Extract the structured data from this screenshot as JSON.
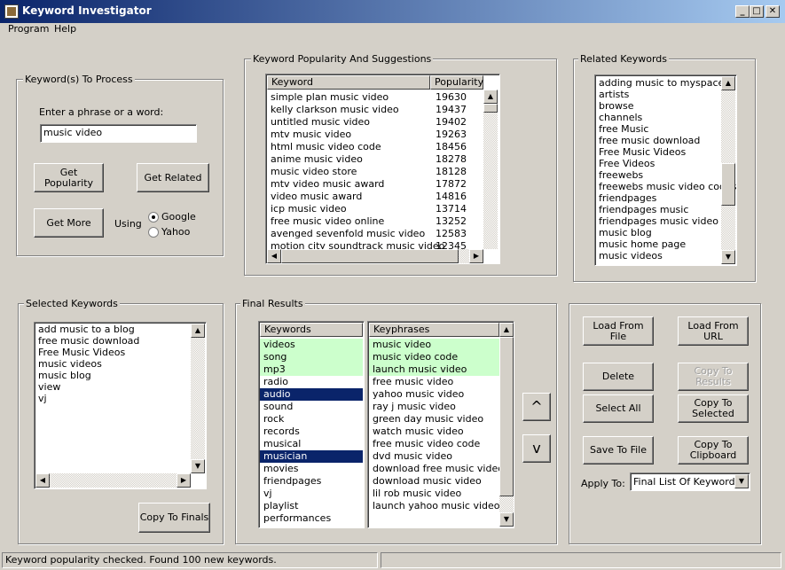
{
  "window": {
    "title": "Keyword Investigator",
    "minimize": "_",
    "maximize": "□",
    "close": "✕"
  },
  "menu": [
    "Program",
    "Help"
  ],
  "process": {
    "legend": "Keyword(s) To Process",
    "prompt": "Enter a phrase or a word:",
    "input_value": "music video",
    "get_popularity": "Get Popularity",
    "get_related": "Get Related",
    "get_more": "Get More",
    "using_label": "Using",
    "google": "Google",
    "yahoo": "Yahoo",
    "selected_engine": "Google"
  },
  "popularity": {
    "legend": "Keyword Popularity And Suggestions",
    "col_keyword": "Keyword",
    "col_popularity": "Popularity",
    "rows": [
      [
        "simple plan music video",
        "19630"
      ],
      [
        "kelly clarkson music video",
        "19437"
      ],
      [
        "untitled music video",
        "19402"
      ],
      [
        "mtv music video",
        "19263"
      ],
      [
        "html music video code",
        "18456"
      ],
      [
        "anime music video",
        "18278"
      ],
      [
        "music video store",
        "18128"
      ],
      [
        "mtv video music award",
        "17872"
      ],
      [
        "video music award",
        "14816"
      ],
      [
        "icp music video",
        "13714"
      ],
      [
        "free music video online",
        "13252"
      ],
      [
        "avenged sevenfold music video",
        "12583"
      ],
      [
        "motion city soundtrack music video",
        "12345"
      ]
    ]
  },
  "related": {
    "legend": "Related Keywords",
    "items": [
      "adding music to myspace",
      "artists",
      "browse",
      "channels",
      "free Music",
      "free music download",
      "Free Music Videos",
      "Free Videos",
      "freewebs",
      "freewebs music video codes",
      "friendpages",
      "friendpages music",
      "friendpages music video",
      "music blog",
      "music home page",
      "music videos"
    ]
  },
  "selected": {
    "legend": "Selected Keywords",
    "items": [
      "add music to a blog",
      "free music download",
      "Free Music Videos",
      "music videos",
      "music blog",
      "view",
      "vj"
    ],
    "copy_to_finals": "Copy To Finals"
  },
  "final": {
    "legend": "Final Results",
    "col_keywords": "Keywords",
    "col_keyphrases": "Keyphrases",
    "keywords": [
      {
        "text": "videos",
        "state": "green"
      },
      {
        "text": "song",
        "state": "green"
      },
      {
        "text": "mp3",
        "state": "green"
      },
      {
        "text": "radio",
        "state": ""
      },
      {
        "text": "audio",
        "state": "sel"
      },
      {
        "text": "sound",
        "state": ""
      },
      {
        "text": "rock",
        "state": ""
      },
      {
        "text": "records",
        "state": ""
      },
      {
        "text": "musical",
        "state": ""
      },
      {
        "text": "musician",
        "state": "sel"
      },
      {
        "text": "movies",
        "state": ""
      },
      {
        "text": "friendpages",
        "state": ""
      },
      {
        "text": "vj",
        "state": ""
      },
      {
        "text": "playlist",
        "state": ""
      },
      {
        "text": "performances",
        "state": ""
      }
    ],
    "keyphrases": [
      {
        "text": "music video",
        "state": "green"
      },
      {
        "text": "music video code",
        "state": "green"
      },
      {
        "text": "launch music video",
        "state": "green"
      },
      {
        "text": "free music video",
        "state": ""
      },
      {
        "text": "yahoo music video",
        "state": ""
      },
      {
        "text": "ray j music video",
        "state": ""
      },
      {
        "text": "green day music video",
        "state": ""
      },
      {
        "text": "watch music video",
        "state": ""
      },
      {
        "text": "free music video code",
        "state": ""
      },
      {
        "text": "dvd music video",
        "state": ""
      },
      {
        "text": "download free music video",
        "state": ""
      },
      {
        "text": "download music video",
        "state": ""
      },
      {
        "text": "lil rob music video",
        "state": ""
      },
      {
        "text": "launch yahoo music video",
        "state": ""
      }
    ],
    "move_up": "^",
    "move_down": "v"
  },
  "actions": {
    "load_from_file": "Load From File",
    "load_from_url": "Load From URL",
    "delete": "Delete",
    "copy_to_results": "Copy To Results",
    "select_all": "Select All",
    "copy_to_selected": "Copy To Selected",
    "save_to_file": "Save To File",
    "copy_to_clipboard": "Copy To Clipboard",
    "apply_to_label": "Apply To:",
    "apply_to_value": "Final List Of Keywords"
  },
  "status": {
    "text": "Keyword popularity checked. Found 100 new keywords."
  }
}
